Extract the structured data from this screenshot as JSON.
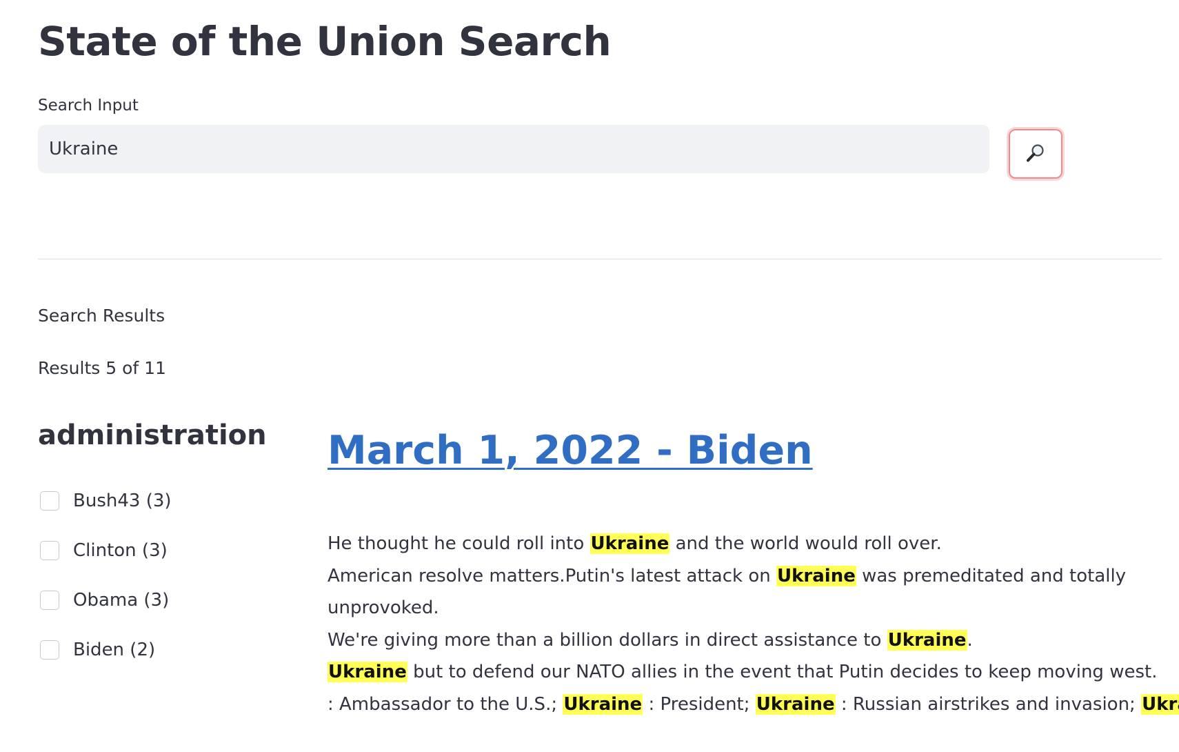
{
  "app": {
    "title": "State of the Union Search"
  },
  "search": {
    "label": "Search Input",
    "value": "Ukraine",
    "button_icon": "magnifying-glass-icon"
  },
  "results": {
    "section_label": "Search Results",
    "count_text": "Results 5 of 11"
  },
  "facets": {
    "heading": "administration",
    "items": [
      {
        "label": "Bush43 (3)",
        "checked": false
      },
      {
        "label": "Clinton (3)",
        "checked": false
      },
      {
        "label": "Obama (3)",
        "checked": false
      },
      {
        "label": "Biden (2)",
        "checked": false
      }
    ]
  },
  "result": {
    "title": "March 1, 2022 - Biden",
    "highlight_color": "#ffff56",
    "link_color": "#2f6ec3",
    "snippet_lines": [
      [
        {
          "t": "He thought he could roll into "
        },
        {
          "t": "Ukraine",
          "hl": true
        },
        {
          "t": " and the world would roll over."
        }
      ],
      [
        {
          "t": "American resolve matters.Putin's latest attack on "
        },
        {
          "t": "Ukraine",
          "hl": true
        },
        {
          "t": " was premeditated and totally"
        }
      ],
      [
        {
          "t": "unprovoked."
        }
      ],
      [
        {
          "t": "We're giving more than a billion dollars in direct assistance to "
        },
        {
          "t": "Ukraine",
          "hl": true
        },
        {
          "t": "."
        }
      ],
      [
        {
          "t": "Ukraine",
          "hl": true
        },
        {
          "t": " but to defend our NATO allies in the event that Putin decides to keep moving west."
        }
      ],
      [
        {
          "t": ": Ambassador to the U.S.; "
        },
        {
          "t": "Ukraine",
          "hl": true
        },
        {
          "t": " : President; "
        },
        {
          "t": "Ukraine",
          "hl": true
        },
        {
          "t": " : Russian airstrikes and invasion; "
        },
        {
          "t": "Ukraine",
          "hl": true
        },
        {
          "t": " :"
        }
      ]
    ]
  }
}
